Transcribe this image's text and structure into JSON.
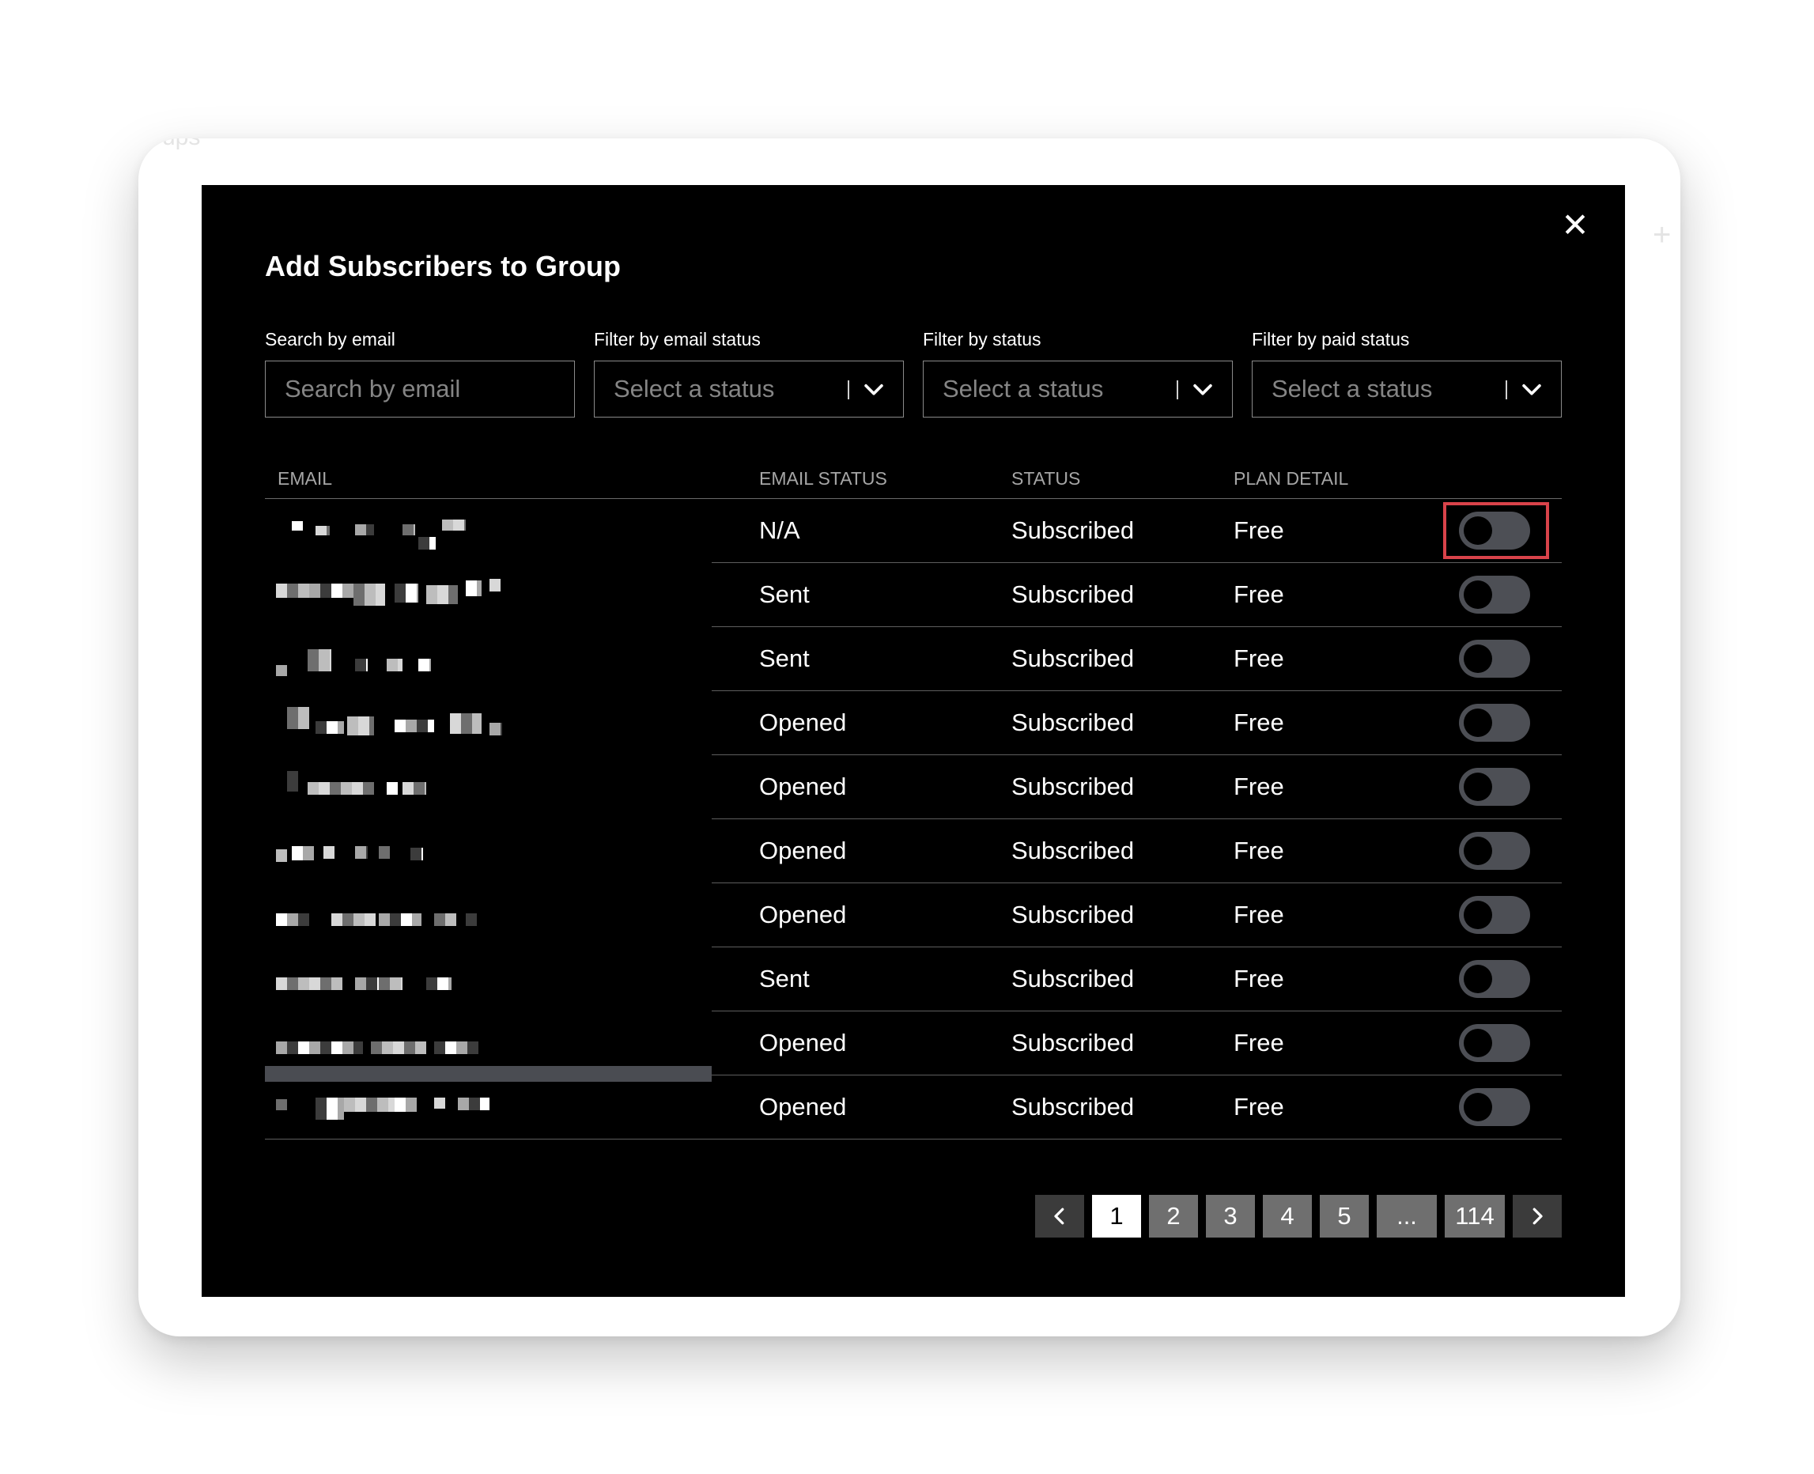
{
  "modal": {
    "title": "Add Subscribers to Group",
    "close_icon": "close-icon"
  },
  "filters": {
    "search": {
      "label": "Search by email",
      "placeholder": "Search by email"
    },
    "email_status": {
      "label": "Filter by email status",
      "placeholder": "Select a status"
    },
    "status": {
      "label": "Filter by status",
      "placeholder": "Select a status"
    },
    "paid_status": {
      "label": "Filter by paid status",
      "placeholder": "Select a status"
    }
  },
  "table": {
    "headers": {
      "email": "EMAIL",
      "email_status": "EMAIL STATUS",
      "status": "STATUS",
      "plan": "PLAN DETAIL"
    },
    "rows": [
      {
        "email_status": "N/A",
        "status": "Subscribed",
        "plan": "Free",
        "selected": false
      },
      {
        "email_status": "Sent",
        "status": "Subscribed",
        "plan": "Free",
        "selected": false
      },
      {
        "email_status": "Sent",
        "status": "Subscribed",
        "plan": "Free",
        "selected": false
      },
      {
        "email_status": "Opened",
        "status": "Subscribed",
        "plan": "Free",
        "selected": false
      },
      {
        "email_status": "Opened",
        "status": "Subscribed",
        "plan": "Free",
        "selected": false
      },
      {
        "email_status": "Opened",
        "status": "Subscribed",
        "plan": "Free",
        "selected": false
      },
      {
        "email_status": "Opened",
        "status": "Subscribed",
        "plan": "Free",
        "selected": false
      },
      {
        "email_status": "Sent",
        "status": "Subscribed",
        "plan": "Free",
        "selected": false
      },
      {
        "email_status": "Opened",
        "status": "Subscribed",
        "plan": "Free",
        "selected": false
      },
      {
        "email_status": "Opened",
        "status": "Subscribed",
        "plan": "Free",
        "selected": false
      }
    ]
  },
  "pagination": {
    "prev_icon": "chevron-left-icon",
    "next_icon": "chevron-right-icon",
    "pages": [
      "1",
      "2",
      "3",
      "4",
      "5",
      "...",
      "114"
    ],
    "current": "1"
  },
  "colors": {
    "modal_bg": "#000000",
    "toggle_off": "#4d4f55",
    "highlight": "#d9434a",
    "page_button": "#6f6f6f"
  }
}
